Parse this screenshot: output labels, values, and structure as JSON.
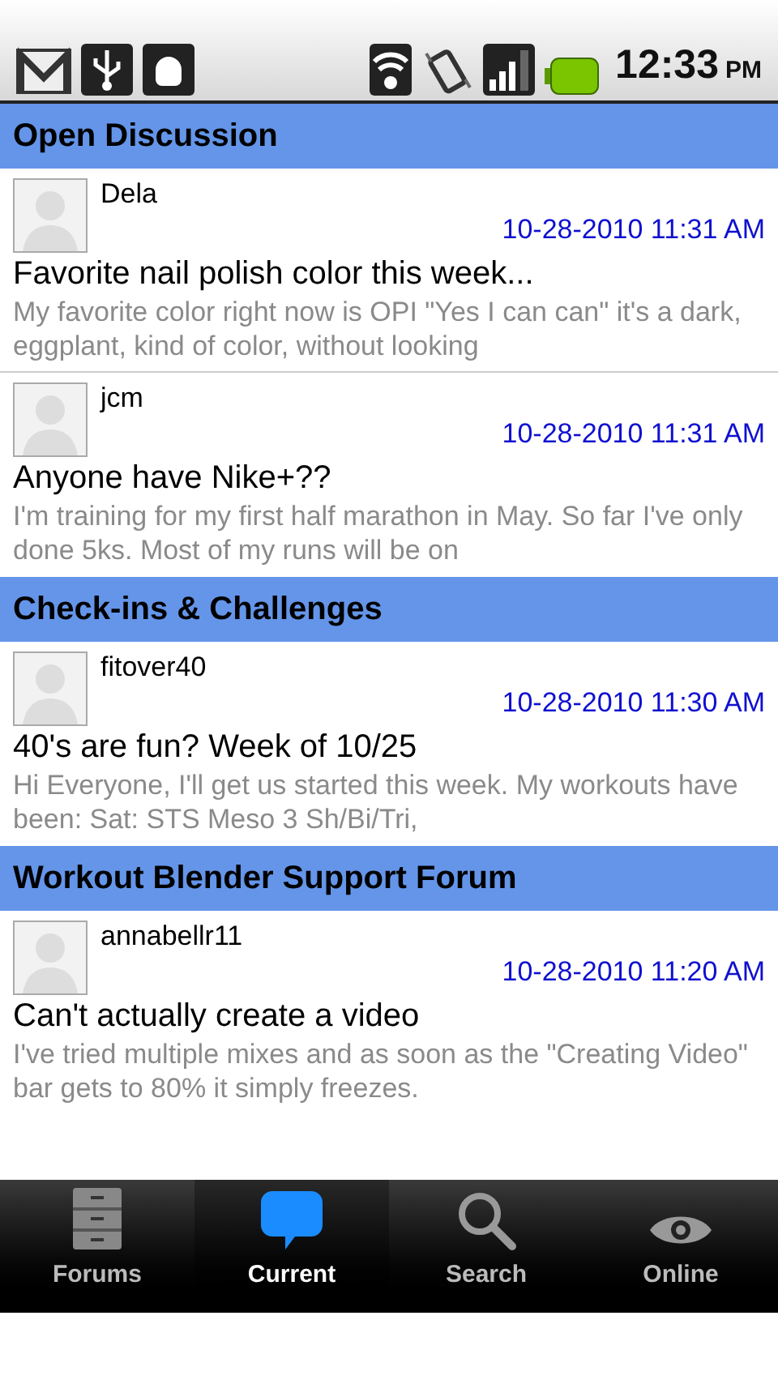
{
  "status_bar": {
    "time": "12:33",
    "ampm": "PM"
  },
  "sections": [
    {
      "title": "Open Discussion",
      "posts": [
        {
          "author": "Dela",
          "date": "10-28-2010 11:31 AM",
          "title": "Favorite nail polish color this week...",
          "preview": "My favorite color right now is OPI \"Yes I can can\" it's a dark, eggplant, kind of color, without looking"
        },
        {
          "author": "jcm",
          "date": "10-28-2010 11:31 AM",
          "title": "Anyone have Nike+??",
          "preview": "I'm training for my first half marathon in May.  So far I've only done 5ks.  Most of my runs will be on"
        }
      ]
    },
    {
      "title": "Check-ins & Challenges",
      "posts": [
        {
          "author": "fitover40",
          "date": "10-28-2010 11:30 AM",
          "title": "40's are fun?  Week of 10/25",
          "preview": "Hi Everyone, I'll get us started this week.  My workouts have been: Sat: STS Meso 3 Sh/Bi/Tri,"
        }
      ]
    },
    {
      "title": "Workout Blender Support Forum",
      "posts": [
        {
          "author": "annabellr11",
          "date": "10-28-2010 11:20 AM",
          "title": "Can't actually create a video",
          "preview": "I've tried multiple mixes and as soon as the \"Creating Video\" bar gets to 80% it simply freezes."
        }
      ]
    }
  ],
  "tabs": [
    {
      "kind": "forums",
      "label": "Forums",
      "selected": false
    },
    {
      "kind": "current",
      "label": "Current",
      "selected": true
    },
    {
      "kind": "search",
      "label": "Search",
      "selected": false
    },
    {
      "kind": "online",
      "label": "Online",
      "selected": false
    }
  ]
}
